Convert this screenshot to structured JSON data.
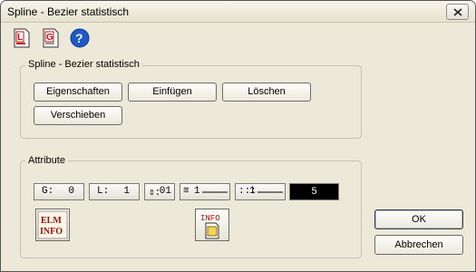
{
  "window": {
    "title": "Spline - Bezier statistisch"
  },
  "toolbar": {
    "icons": [
      "document-l-icon",
      "document-g-icon",
      "help-icon"
    ],
    "icon_letters": [
      "L",
      "G"
    ],
    "help_glyph": "?"
  },
  "spline_group": {
    "label": "Spline - Bezier statistisch",
    "buttons": [
      "Eigenschaften",
      "Einfügen",
      "Löschen",
      "Verschieben"
    ]
  },
  "attribute_group": {
    "label": "Attribute",
    "cells": [
      {
        "label": "G:",
        "value": "0"
      },
      {
        "label": "L:",
        "value": "1"
      },
      {
        "label": "⇕:",
        "value": "01"
      },
      {
        "label": "≡",
        "value": "1"
      },
      {
        "label": ":::",
        "value": "1"
      }
    ],
    "color_value": "5",
    "elm_icon_text": [
      "ELM",
      "INFO"
    ],
    "info_icon_text": "INFO"
  },
  "dialog_buttons": {
    "ok": "OK",
    "cancel": "Abbrechen"
  },
  "colors": {
    "face": "#ece9d8",
    "accent_red": "#c21010",
    "help_blue": "#1f59c8"
  }
}
